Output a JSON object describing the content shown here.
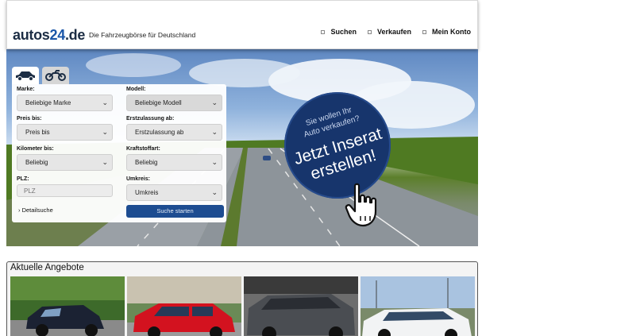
{
  "header": {
    "logo_text": "autos",
    "logo_num": "24",
    "logo_domain": ".de",
    "tagline": "Die Fahrzeugbörse für Deutschland",
    "nav": [
      {
        "label": "Suchen"
      },
      {
        "label": "Verkaufen"
      },
      {
        "label": "Mein Konto"
      }
    ]
  },
  "search": {
    "tabs": [
      {
        "icon": "car-icon"
      },
      {
        "icon": "motorcycle-icon"
      }
    ],
    "fields": {
      "marke": {
        "label": "Marke:",
        "value": "Beliebige Marke"
      },
      "modell": {
        "label": "Modell:",
        "value": "Beliebige Modell"
      },
      "preis": {
        "label": "Preis bis:",
        "value": "Preis bis"
      },
      "erstzulassung": {
        "label": "Erstzulassung ab:",
        "value": "Erstzulassung ab"
      },
      "kilometer": {
        "label": "Kilometer bis:",
        "value": "Beliebig"
      },
      "kraftstoff": {
        "label": "Kraftstoffart:",
        "value": "Beliebig"
      },
      "plz": {
        "label": "PLZ:",
        "placeholder": "PLZ"
      },
      "umkreis": {
        "label": "Umkreis:",
        "value": "Umkreis"
      }
    },
    "detail_link": "› Detailsuche",
    "submit_label": "Suche starten"
  },
  "promo": {
    "line1": "Sie wollen Ihr",
    "line2": "Auto verkaufen?",
    "line3": "Jetzt Inserat",
    "line4": "erstellen!"
  },
  "offers": {
    "title": "Aktuelle Angebote",
    "items": [
      {
        "car_color": "#1b2233"
      },
      {
        "car_color": "#d3121f"
      },
      {
        "car_color": "#4a4d52"
      },
      {
        "car_color": "#f2f3f4"
      }
    ]
  },
  "colors": {
    "brand_blue": "#1d4c91",
    "promo_blue": "#17356c"
  }
}
